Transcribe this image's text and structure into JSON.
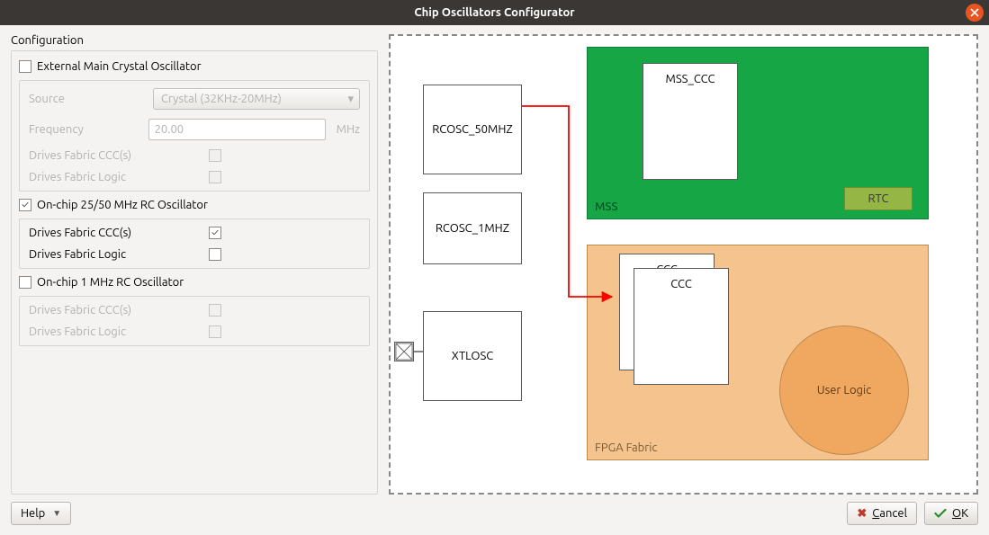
{
  "window": {
    "title": "Chip Oscillators Configurator"
  },
  "config": {
    "heading": "Configuration",
    "ext_osc": {
      "title": "External Main Crystal Oscillator",
      "checked": false,
      "source_label": "Source",
      "source_value": "Crystal (32KHz-20MHz)",
      "freq_label": "Frequency",
      "freq_value": "20.00",
      "freq_unit": "MHz",
      "drives_ccc_label": "Drives Fabric CCC(s)",
      "drives_ccc_checked": false,
      "drives_logic_label": "Drives Fabric Logic",
      "drives_logic_checked": false
    },
    "rc2550": {
      "title": "On-chip 25/50 MHz RC Oscillator",
      "checked": true,
      "drives_ccc_label": "Drives Fabric CCC(s)",
      "drives_ccc_checked": true,
      "drives_logic_label": "Drives Fabric Logic",
      "drives_logic_checked": false
    },
    "rc1": {
      "title": "On-chip 1 MHz RC Oscillator",
      "checked": false,
      "drives_ccc_label": "Drives Fabric CCC(s)",
      "drives_ccc_checked": false,
      "drives_logic_label": "Drives Fabric Logic",
      "drives_logic_checked": false
    }
  },
  "diagram": {
    "rcosc50": "RCOSC_50MHZ",
    "rcosc1": "RCOSC_1MHZ",
    "xtlosc": "XTLOSC",
    "mss": "MSS",
    "mss_ccc": "MSS_CCC",
    "rtc": "RTC",
    "fabric": "FPGA Fabric",
    "ccc": "CCC",
    "user_logic": "User Logic"
  },
  "footer": {
    "help": "Help",
    "cancel": "Cancel",
    "ok": "OK"
  }
}
